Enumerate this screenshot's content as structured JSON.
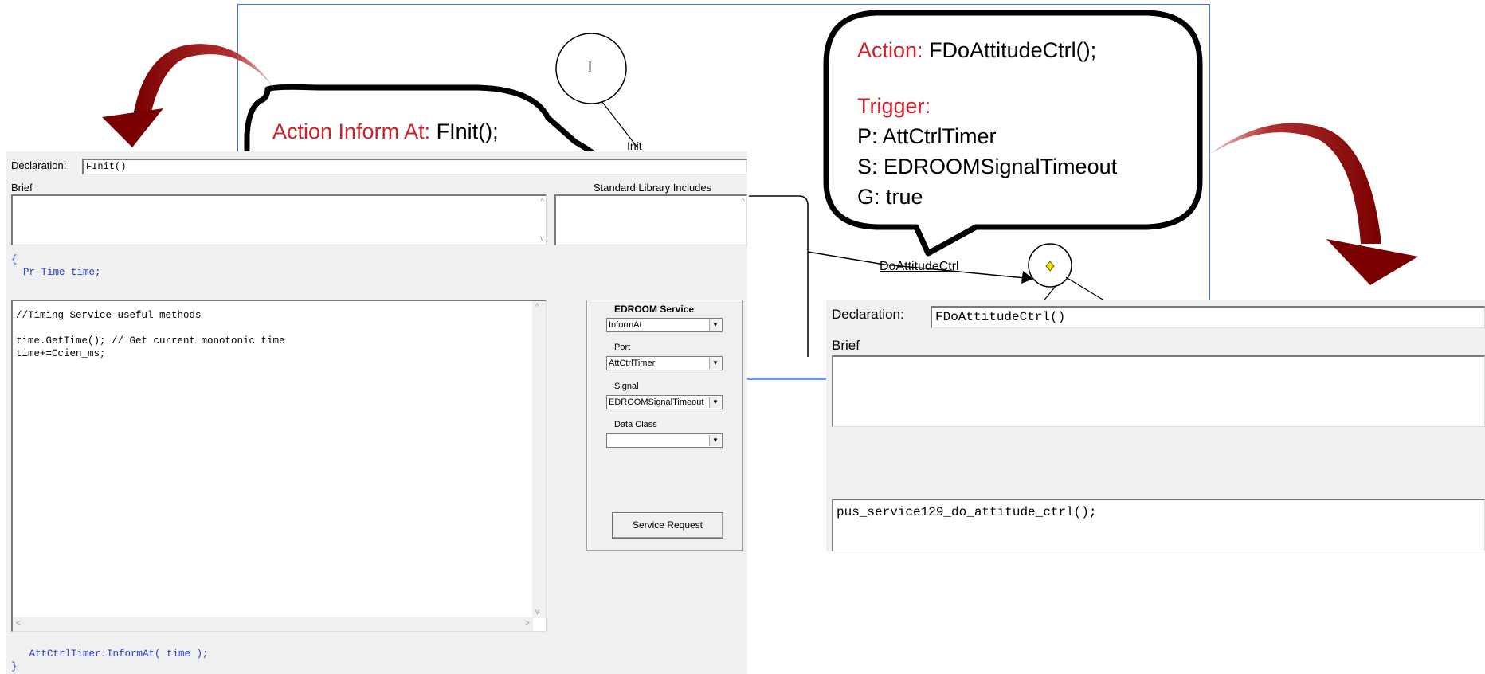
{
  "diagram": {
    "init_state_label": "I",
    "init_transition_label": "Init",
    "transition_label": "DoAttitudeCtrl"
  },
  "bubble_left": {
    "keyword": "Action Inform At:",
    "function": "FInit();"
  },
  "bubble_right": {
    "action_keyword": "Action:",
    "action_function": "FDoAttitudeCtrl();",
    "trigger_keyword": "Trigger:",
    "lines": [
      "P: AttCtrlTimer",
      "S: EDROOMSignalTimeout",
      "G: true"
    ]
  },
  "left_panel": {
    "declaration_label": "Declaration:",
    "declaration_value": "FInit()",
    "brief_label": "Brief",
    "std_lib_label": "Standard Library Includes",
    "pre_code": [
      "{",
      "  Pr_Time time;"
    ],
    "code_lines": [
      "//Timing Service useful methods",
      "",
      "time.GetTime(); // Get current monotonic time",
      "time+=Ccien_ms;"
    ],
    "post_code": [
      "   AttCtrlTimer.InformAt( time );",
      "}"
    ],
    "service": {
      "title": "EDROOM Service",
      "service_value": "InformAt",
      "port_label": "Port",
      "port_value": "AttCtrlTimer",
      "signal_label": "Signal",
      "signal_value": "EDROOMSignalTimeout",
      "data_class_label": "Data Class",
      "data_class_value": "",
      "button_label": "Service Request"
    }
  },
  "right_panel": {
    "declaration_label": "Declaration:",
    "declaration_value": "FDoAttitudeCtrl()",
    "brief_label": "Brief",
    "code_line": "pus_service129_do_attitude_ctrl();"
  },
  "colors": {
    "accent_red": "#d0202a",
    "arrow_red": "#8b0b0b",
    "frame_blue": "#3b78e7",
    "code_blue": "#1f3fd1"
  }
}
